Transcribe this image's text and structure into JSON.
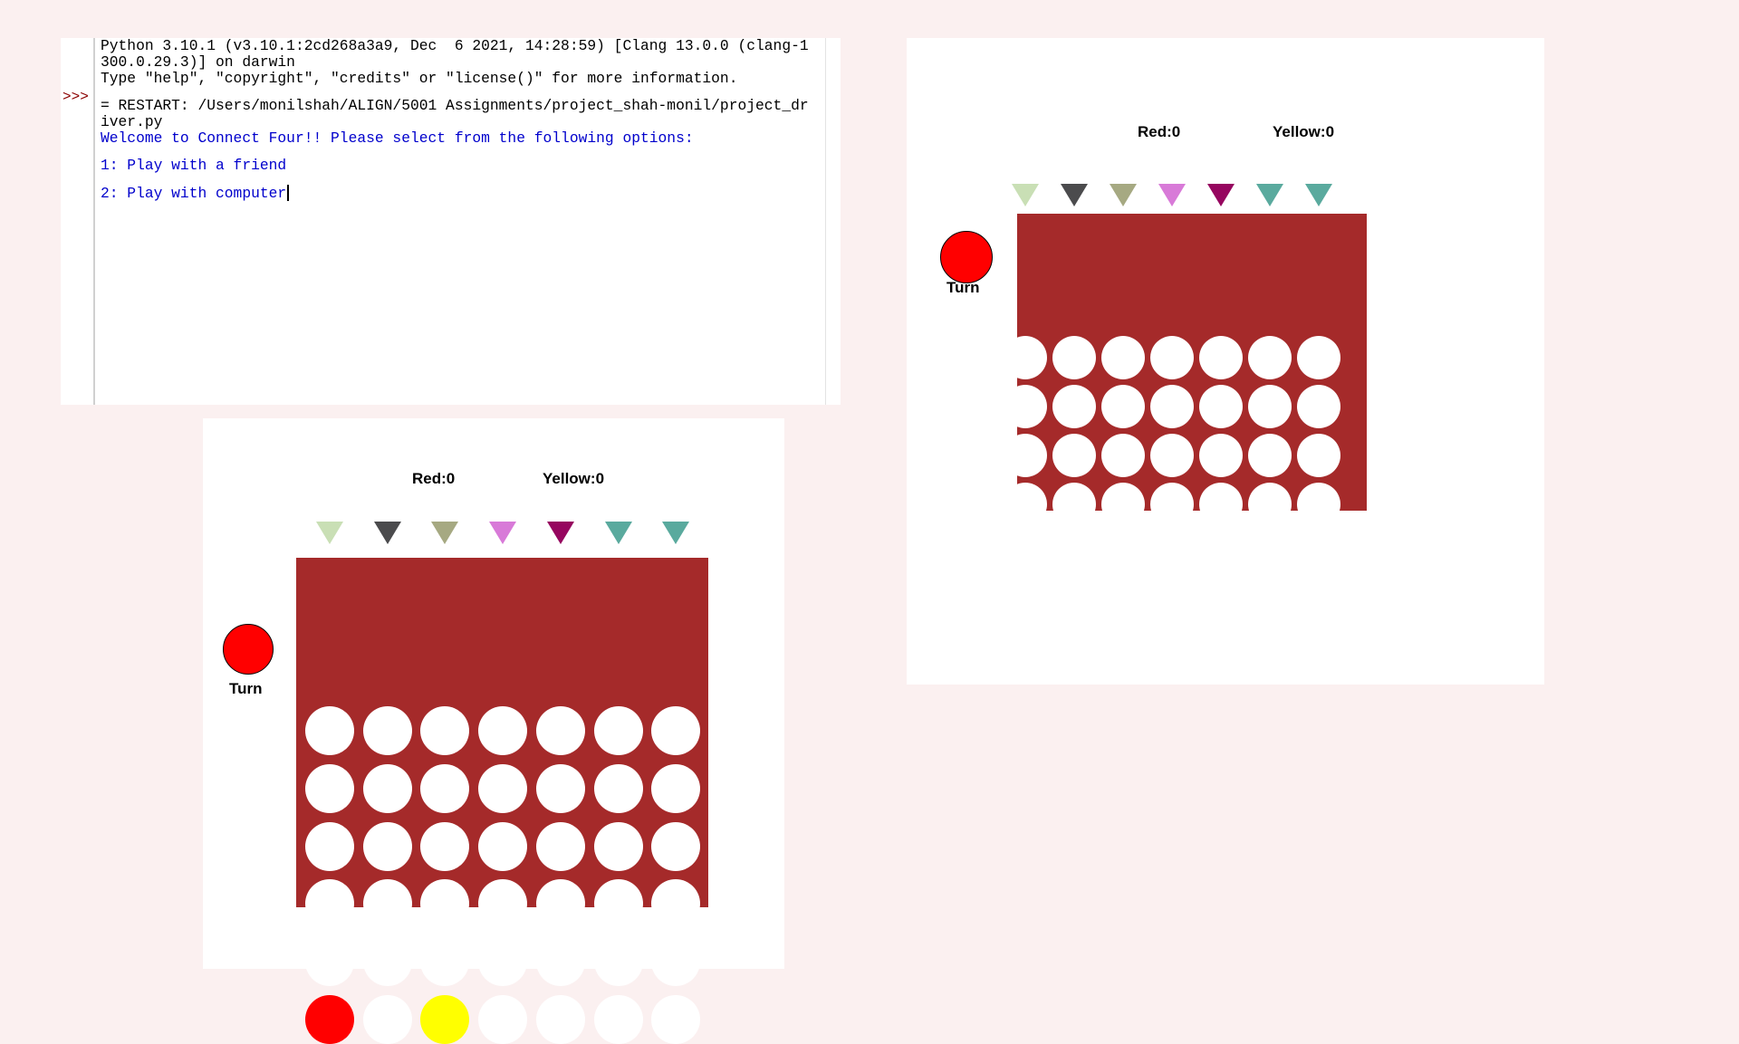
{
  "shell": {
    "prompt": ">>>",
    "lines": [
      {
        "text": "Python 3.10.1 (v3.10.1:2cd268a3a9, Dec  6 2021, 14:28:59) [Clang 13.0.0 (clang-1",
        "style": "normal"
      },
      {
        "text": "300.0.29.3)] on darwin",
        "style": "normal"
      },
      {
        "text": "Type \"help\", \"copyright\", \"credits\" or \"license()\" for more information.",
        "style": "normal"
      },
      {
        "text": "",
        "style": "normal"
      },
      {
        "text": "= RESTART: /Users/monilshah/ALIGN/5001 Assignments/project_shah-monil/project_dr",
        "style": "normal"
      },
      {
        "text": "iver.py",
        "style": "normal"
      },
      {
        "text": "Welcome to Connect Four!! Please select from the following options:",
        "style": "blue"
      },
      {
        "text": "",
        "style": "normal"
      },
      {
        "text": "1: Play with a friend",
        "style": "blue"
      },
      {
        "text": "",
        "style": "normal"
      },
      {
        "text": "2: Play with computer",
        "style": "blue"
      }
    ]
  },
  "games": [
    {
      "id": "game-window-top-right",
      "red_score": "Red:0",
      "yellow_score": "Yellow:0",
      "turn_label": "Turn",
      "turn_color": "#ff0000",
      "arrow_colors": [
        "#c9dfb5",
        "#4b4b4d",
        "#a6a982",
        "#d87ad8",
        "#96065f",
        "#5aaa9e",
        "#5aaa9e"
      ],
      "board_color": "#a52a2a",
      "pieces": [
        [
          "empty",
          "empty",
          "empty",
          "empty",
          "empty",
          "empty",
          "empty"
        ],
        [
          "empty",
          "empty",
          "empty",
          "empty",
          "empty",
          "empty",
          "empty"
        ],
        [
          "empty",
          "empty",
          "empty",
          "empty",
          "empty",
          "empty",
          "empty"
        ],
        [
          "empty",
          "empty",
          "empty",
          "empty",
          "empty",
          "empty",
          "empty"
        ],
        [
          "empty",
          "empty",
          "empty",
          "empty",
          "empty",
          "empty",
          "empty"
        ],
        [
          "empty",
          "empty",
          "empty",
          "empty",
          "empty",
          "empty",
          "empty"
        ]
      ]
    },
    {
      "id": "game-window-bottom-left",
      "red_score": "Red:0",
      "yellow_score": "Yellow:0",
      "turn_label": "Turn",
      "turn_color": "#ff0000",
      "arrow_colors": [
        "#c9dfb5",
        "#4b4b4d",
        "#a6a982",
        "#d87ad8",
        "#96065f",
        "#5aaa9e",
        "#5aaa9e"
      ],
      "board_color": "#a52a2a",
      "pieces": [
        [
          "empty",
          "empty",
          "empty",
          "empty",
          "empty",
          "empty",
          "empty"
        ],
        [
          "empty",
          "empty",
          "empty",
          "empty",
          "empty",
          "empty",
          "empty"
        ],
        [
          "empty",
          "empty",
          "empty",
          "empty",
          "empty",
          "empty",
          "empty"
        ],
        [
          "empty",
          "empty",
          "empty",
          "empty",
          "empty",
          "empty",
          "empty"
        ],
        [
          "empty",
          "empty",
          "empty",
          "empty",
          "empty",
          "empty",
          "empty"
        ],
        [
          "red",
          "empty",
          "yellow",
          "empty",
          "empty",
          "empty",
          "empty"
        ]
      ]
    }
  ],
  "piece_colors": {
    "empty": "#ffffff",
    "red": "#ff0000",
    "yellow": "#ffff00"
  }
}
